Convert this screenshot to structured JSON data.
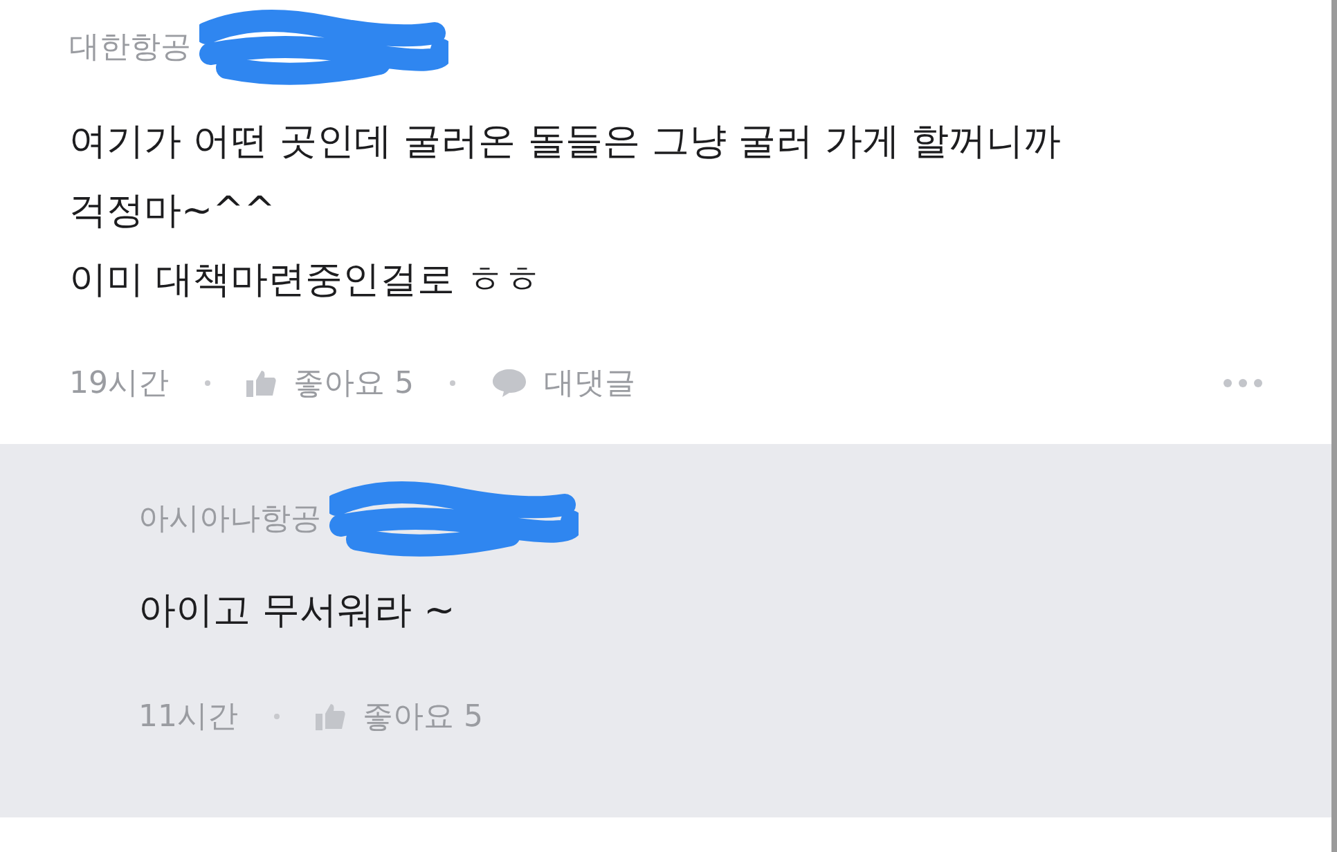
{
  "comments": [
    {
      "author": "대한항공",
      "text": "여기가 어떤 곳인데 굴러온 돌들은 그냥 굴러 가게 할꺼니까\n걱정마~^^\n이미 대책마련중인걸로 ㅎㅎ",
      "time": "19시간",
      "likes": "좋아요 5",
      "reply_label": "대댓글",
      "is_reply": false
    },
    {
      "author": "아시아나항공",
      "text": "아이고 무서워라 ~",
      "time": "11시간",
      "likes": "좋아요 5",
      "is_reply": true
    }
  ]
}
